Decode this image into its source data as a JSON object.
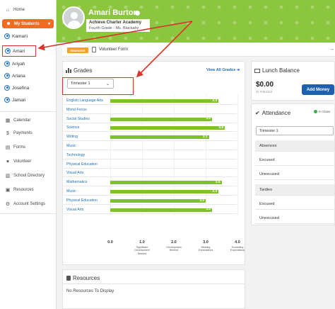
{
  "sidebar": {
    "home": "Home",
    "my_students": "My Students",
    "students": [
      "Kamarii",
      "Amari",
      "Ariyah",
      "Ariana",
      "Josefina",
      "Jamari"
    ],
    "selected_student": "Amari",
    "menu": [
      "Calendar",
      "Payments",
      "Forms",
      "Volunteer",
      "School Directory",
      "Resources",
      "Account Settings"
    ]
  },
  "header": {
    "name": "Amari Burton",
    "school": "Achieve Charter Academy",
    "grade_line": "Fourth Grade - Ms. Blackaby",
    "accent": "#8cc63f"
  },
  "reminder": {
    "tag": "REMINDER",
    "text": "Volunteer Form"
  },
  "grades": {
    "title": "Grades",
    "view_all": "View All Grades",
    "term": "Trimester 1",
    "accent": "#7ec12a"
  },
  "chart_data": {
    "type": "bar",
    "orientation": "horizontal",
    "categories": [
      "English Language Arts",
      "Moral Focus",
      "Social Studies",
      "Science",
      "Writing",
      "Music",
      "Technology",
      "Physical Education",
      "Visual Arts",
      "Mathematics",
      "Music",
      "Physical Education",
      "Visual Arts"
    ],
    "values": [
      3.4,
      null,
      3.2,
      3.6,
      3.1,
      null,
      null,
      null,
      null,
      3.5,
      3.4,
      3.0,
      3.2
    ],
    "value_labels": [
      "3.4",
      "",
      "3.2",
      "3.6",
      "3.1",
      "",
      "",
      "",
      "",
      "3.5",
      "3.4",
      "3.0",
      "3.2"
    ],
    "xlim": [
      0,
      4
    ],
    "ticks": [
      "0.0",
      "1.0",
      "2.0",
      "3.0",
      "4.0"
    ],
    "tick_descriptions": [
      "",
      "Significant Development Needed",
      "Development Needed",
      "Meeting Expectations",
      "Exceeding Expectations"
    ]
  },
  "resources": {
    "title": "Resources",
    "empty": "No Resources To Display"
  },
  "lunch": {
    "title": "Lunch Balance",
    "balance": "$0.00",
    "id": "ID #364322",
    "button": "Add Money"
  },
  "attendance": {
    "title": "Attendance",
    "status": "In Class",
    "term": "Trimester 1",
    "rows": [
      {
        "label": "Absences",
        "head": true
      },
      {
        "label": "Excused",
        "head": false
      },
      {
        "label": "Unexcused",
        "head": false
      },
      {
        "label": "Tardies",
        "head": true
      },
      {
        "label": "Excused",
        "head": false
      },
      {
        "label": "Unexcused",
        "head": false
      }
    ]
  }
}
